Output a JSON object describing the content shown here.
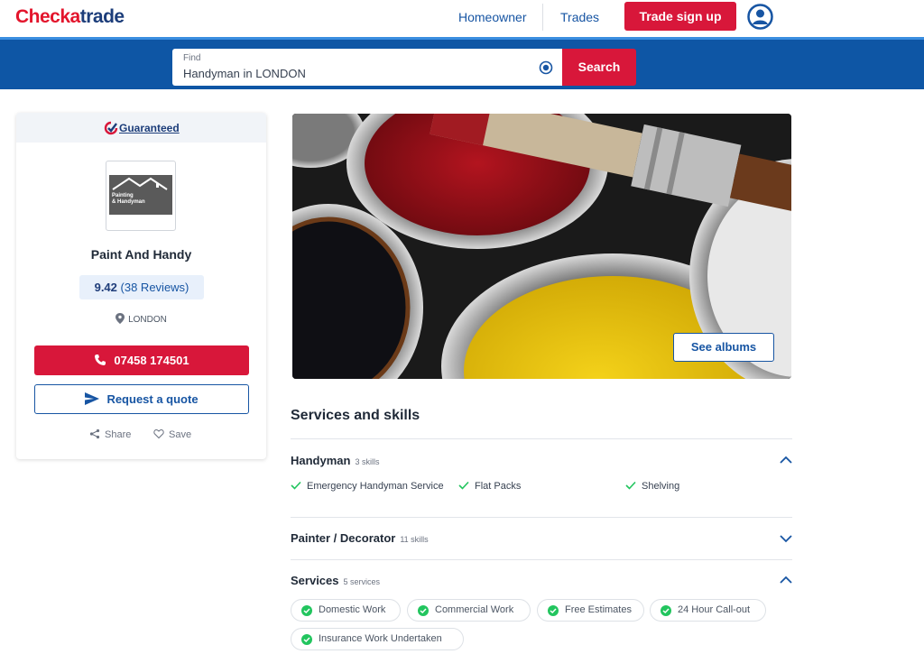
{
  "header": {
    "logo_part1": "Check",
    "logo_part2": "a",
    "logo_part3": "trade",
    "nav_homeowner": "Homeowner",
    "nav_trades": "Trades",
    "trade_signup": "Trade sign up"
  },
  "search": {
    "label": "Find",
    "value": "Handyman in LONDON",
    "button": "Search"
  },
  "profile": {
    "guaranteed": "Guaranteed",
    "logo_line1": "Painting",
    "logo_line2": "& Handyman",
    "name": "Paint And Handy",
    "score": "9.42",
    "reviews": "(38 Reviews)",
    "location": "LONDON",
    "phone": "07458 174501",
    "quote_button": "Request a quote",
    "share": "Share",
    "save": "Save"
  },
  "gallery": {
    "albums_button": "See albums"
  },
  "services": {
    "title": "Services and skills",
    "categories": [
      {
        "name": "Handyman",
        "count": "3 skills",
        "expanded": true,
        "skills": [
          "Emergency Handyman Service",
          "Flat Packs",
          "Shelving"
        ]
      },
      {
        "name": "Painter / Decorator",
        "count": "11 skills",
        "expanded": false
      },
      {
        "name": "Services",
        "count": "5 services",
        "expanded": true,
        "items": [
          "Domestic Work",
          "Commercial Work",
          "Free Estimates",
          "24 Hour Call-out",
          "Insurance Work Undertaken"
        ]
      }
    ]
  },
  "colors": {
    "brand_red": "#d8173a",
    "brand_blue": "#0e56a5",
    "link_blue": "#1755a3",
    "check_green": "#22c55e"
  }
}
